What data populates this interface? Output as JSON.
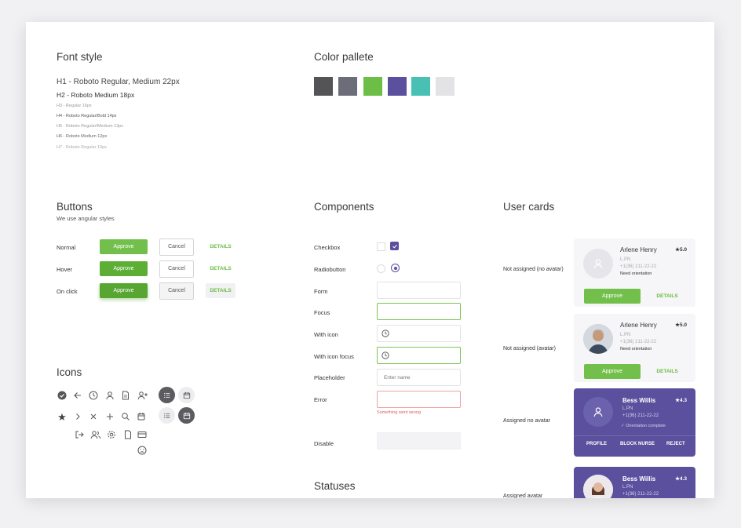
{
  "font_style": {
    "title": "Font style",
    "rows": [
      "H1 - Roboto Regular, Medium 22px",
      "H2 - Roboto Medium 18px",
      "H3 - Regular 16px",
      "H4 - Roboto Regular/Bold 14px",
      "H5 - Roboto Regular/Medium 13px",
      "H6 - Roboto Medium 12px",
      "H7 - Roboto Regular 10px"
    ]
  },
  "color_palette": {
    "title": "Color pallete",
    "colors": [
      "#545457",
      "#6b6e78",
      "#6cbe47",
      "#5a509d",
      "#48c1b4",
      "#e3e3e6"
    ]
  },
  "buttons": {
    "title": "Buttons",
    "subtitle": "We use angular styles",
    "rows": [
      {
        "state": "Normal",
        "approve": "Approve",
        "cancel": "Cancel",
        "details": "DETAILS"
      },
      {
        "state": "Hover",
        "approve": "Approve",
        "cancel": "Cancel",
        "details": "DETAILS"
      },
      {
        "state": "On click",
        "approve": "Approve",
        "cancel": "Cancel",
        "details": "DETAILS"
      }
    ]
  },
  "icons": {
    "title": "Icons",
    "names": [
      "check-circle-icon",
      "arrow-left-icon",
      "clock-icon",
      "user-icon",
      "document-icon",
      "add-user-icon",
      "list-icon",
      "calendar-icon",
      "star-icon",
      "chevron-right-icon",
      "close-icon",
      "plus-icon",
      "search-icon",
      "calendar-small-icon",
      "list-icon",
      "calendar-icon",
      "logout-icon",
      "users-icon",
      "settings-icon",
      "file-icon",
      "card-icon",
      "sad-face-icon"
    ]
  },
  "components": {
    "title": "Components",
    "rows": [
      {
        "label": "Checkbox"
      },
      {
        "label": "Radiobutton"
      },
      {
        "label": "Form"
      },
      {
        "label": "Focus"
      },
      {
        "label": "With icon"
      },
      {
        "label": "With icon focus"
      },
      {
        "label": "Placeholder",
        "placeholder": "Enter name"
      },
      {
        "label": "Error",
        "error": "Something went wrong"
      },
      {
        "label": "Disable"
      }
    ]
  },
  "statuses": {
    "title": "Statuses"
  },
  "user_cards": {
    "title": "User cards",
    "labels": [
      "Not assigned (no avatar)",
      "Not assigned (avatar)",
      "Assigned no avatar"
    ],
    "cards": [
      {
        "name": "Arlene Henry",
        "rating": "★5.0",
        "role": "L.PN",
        "phone": "+1(36) 211-22-22",
        "note": "Need orientation",
        "approve": "Approve",
        "details": "DETAILS"
      },
      {
        "name": "Arlene Henry",
        "rating": "★5.0",
        "role": "L.PN",
        "phone": "+1(36) 211-22-22",
        "note": "Need orientation",
        "approve": "Approve",
        "details": "DETAILS"
      },
      {
        "name": "Bess Willis",
        "rating": "★4.3",
        "role": "L.PN",
        "phone": "+1(36) 211-22-22",
        "note": "Orientation complete",
        "actions": [
          "PROFILE",
          "BLOCK NURSE",
          "REJECT"
        ]
      },
      {
        "name": "Bess Willis",
        "rating": "★4.3",
        "role": "L.PN",
        "phone": "+1(36) 211-22-22"
      }
    ]
  }
}
